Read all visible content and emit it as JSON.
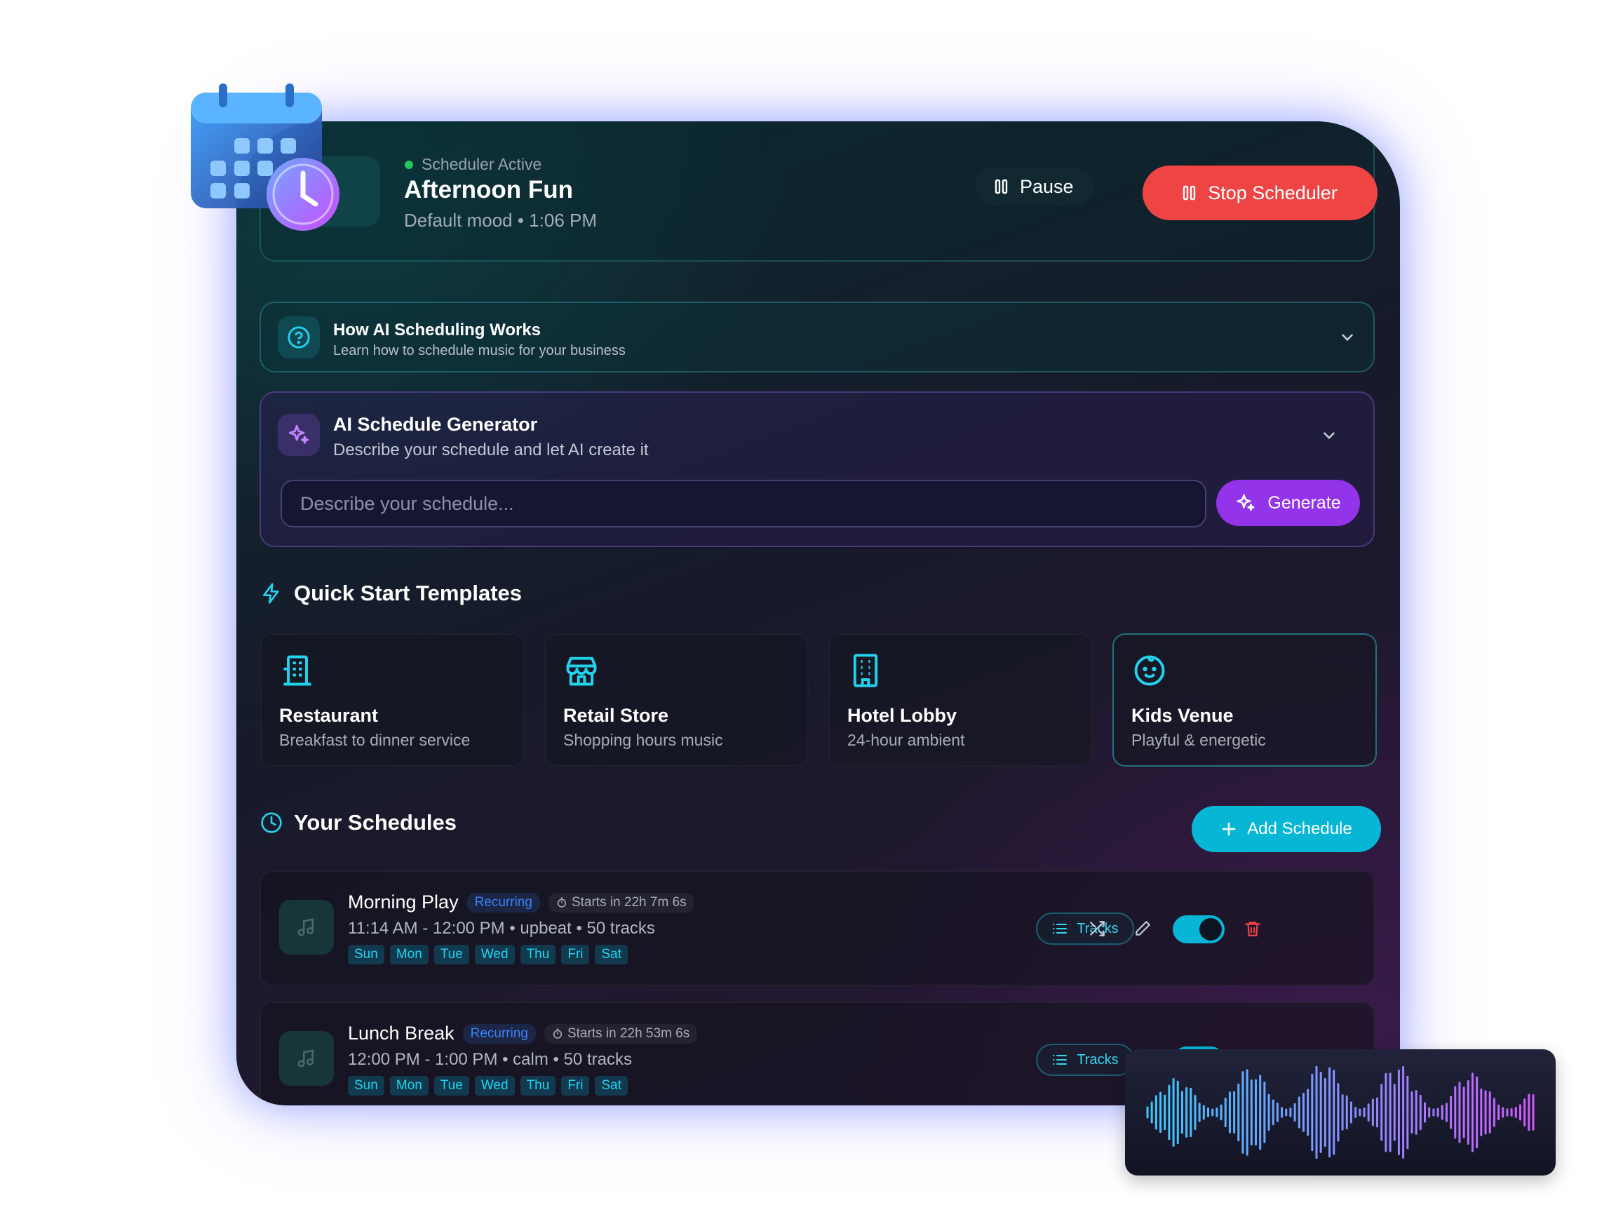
{
  "status": {
    "indicator": "Scheduler Active",
    "title": "Afternoon Fun",
    "subtitle": "Default mood • 1:06 PM",
    "pause_label": "Pause",
    "stop_label": "Stop Scheduler"
  },
  "how_it_works": {
    "title": "How AI Scheduling Works",
    "subtitle": "Learn how to schedule music for your business"
  },
  "generator": {
    "title": "AI Schedule Generator",
    "subtitle": "Describe your schedule and let AI create it",
    "placeholder": "Describe your schedule...",
    "button_label": "Generate"
  },
  "templates": {
    "heading": "Quick Start Templates",
    "items": [
      {
        "title": "Restaurant",
        "subtitle": "Breakfast to dinner service",
        "icon": "restaurant-icon"
      },
      {
        "title": "Retail Store",
        "subtitle": "Shopping hours music",
        "icon": "store-icon"
      },
      {
        "title": "Hotel Lobby",
        "subtitle": "24-hour ambient",
        "icon": "hotel-icon"
      },
      {
        "title": "Kids Venue",
        "subtitle": "Playful & energetic",
        "icon": "baby-face-icon"
      }
    ]
  },
  "schedules": {
    "heading": "Your Schedules",
    "add_label": "Add Schedule",
    "items": [
      {
        "name": "Morning Play",
        "badge": "Recurring",
        "starts": "Starts in 22h 7m 6s",
        "meta": "11:14 AM - 12:00 PM • upbeat • 50 tracks",
        "days": [
          "Sun",
          "Mon",
          "Tue",
          "Wed",
          "Thu",
          "Fri",
          "Sat"
        ],
        "tracks_label": "Tracks",
        "enabled": true
      },
      {
        "name": "Lunch Break",
        "badge": "Recurring",
        "starts": "Starts in 22h 53m 6s",
        "meta": "12:00 PM - 1:00 PM • calm • 50 tracks",
        "days": [
          "Sun",
          "Mon",
          "Tue",
          "Wed",
          "Thu",
          "Fri",
          "Sat"
        ],
        "tracks_label": "Tracks",
        "enabled": true
      }
    ]
  },
  "colors": {
    "accent": "#06b6d4",
    "stop": "#ef4444",
    "generate": "#9333ea",
    "active_dot": "#22c55e",
    "recurring": "#3b82f6"
  }
}
